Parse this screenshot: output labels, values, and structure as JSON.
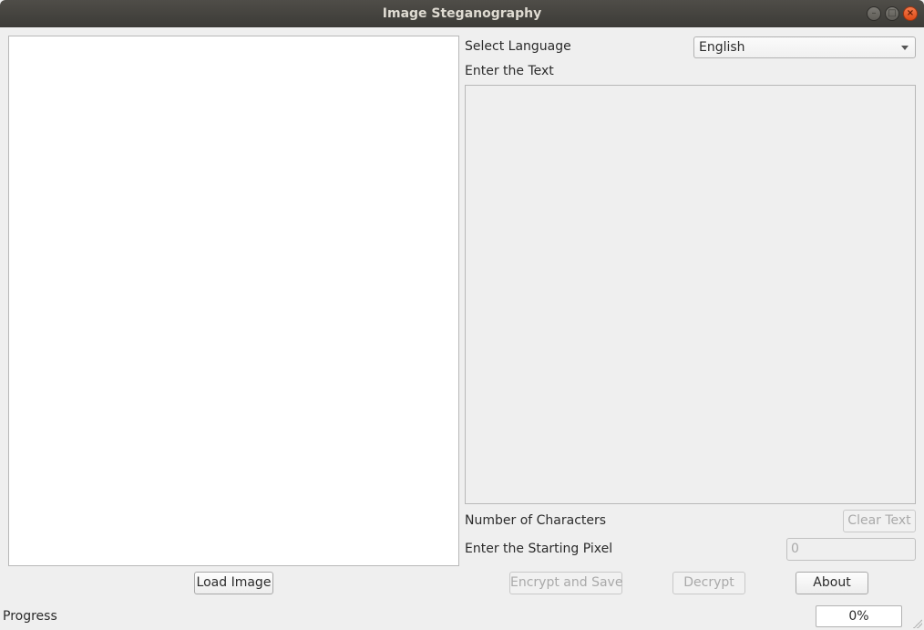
{
  "window": {
    "title": "Image Steganography",
    "buttons": {
      "minimize": "–",
      "maximize": "□",
      "close": "×"
    }
  },
  "language": {
    "label": "Select Language",
    "selected": "English"
  },
  "text_section": {
    "label": "Enter the Text",
    "value": ""
  },
  "characters": {
    "label": "Number of Characters",
    "clear_label": "Clear Text"
  },
  "starting_pixel": {
    "label": "Enter the Starting Pixel",
    "value": "0"
  },
  "buttons": {
    "load_image": "Load Image",
    "encrypt_save": "Encrypt and Save",
    "decrypt": "Decrypt",
    "about": "About"
  },
  "progress": {
    "label": "Progress",
    "value_text": "0%",
    "value": 0
  },
  "colors": {
    "titlebar": "#3c3b37",
    "background": "#efefef",
    "close_button": "#df4a16"
  }
}
